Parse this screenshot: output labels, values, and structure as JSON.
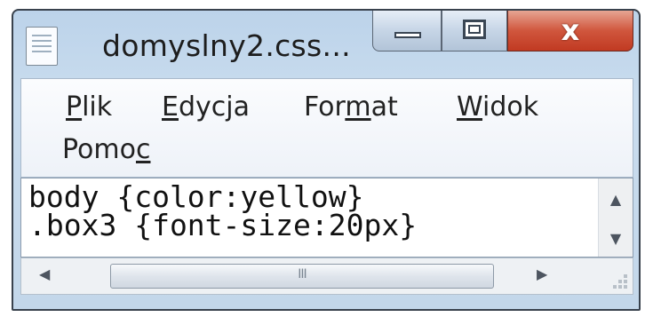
{
  "window": {
    "title": "domyslny2.css...",
    "icon": "notepad-icon",
    "controls": {
      "minimize": "minimize-icon",
      "maximize": "maximize-icon",
      "close": "x"
    }
  },
  "menu": {
    "items": [
      {
        "pre": "",
        "key": "P",
        "post": "lik"
      },
      {
        "pre": "",
        "key": "E",
        "post": "dycja"
      },
      {
        "pre": "For",
        "key": "m",
        "post": "at"
      },
      {
        "pre": "",
        "key": "W",
        "post": "idok"
      },
      {
        "pre": "Pomo",
        "key": "c",
        "post": ""
      }
    ]
  },
  "editor": {
    "lines": [
      "body {color:yellow}",
      ".box3 {font-size:20px}"
    ]
  },
  "scrollbars": {
    "up": "▲",
    "down": "▼",
    "left": "◀",
    "right": "▶",
    "grip": "III"
  },
  "colors": {
    "close_red": "#c13a22",
    "frame": "#c3d7ea"
  }
}
